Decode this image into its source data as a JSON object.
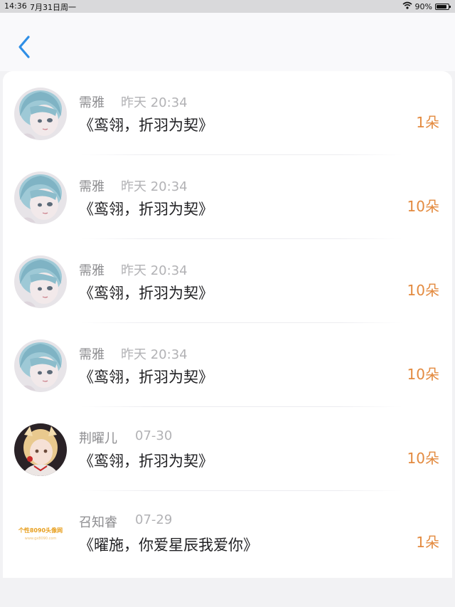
{
  "status_bar": {
    "time": "14:36",
    "date": "7月31日周一",
    "battery": "90%",
    "battery_level": 0.9
  },
  "nav": {
    "back_icon": "chevron-left-icon",
    "accent_color": "#2f8fe6"
  },
  "list": {
    "count_color": "#e38a3f",
    "items": [
      {
        "name": "需雅",
        "time": "昨天 20:34",
        "message": "《鸾翎，折羽为契》",
        "count": "1朵",
        "avatar": "anime-girl-blue-hair"
      },
      {
        "name": "需雅",
        "time": "昨天 20:34",
        "message": "《鸾翎，折羽为契》",
        "count": "10朵",
        "avatar": "anime-girl-blue-hair"
      },
      {
        "name": "需雅",
        "time": "昨天 20:34",
        "message": "《鸾翎，折羽为契》",
        "count": "10朵",
        "avatar": "anime-girl-blue-hair"
      },
      {
        "name": "需雅",
        "time": "昨天 20:34",
        "message": "《鸾翎，折羽为契》",
        "count": "10朵",
        "avatar": "anime-girl-blue-hair"
      },
      {
        "name": "荆曜儿",
        "time": "07-30",
        "message": "《鸾翎，折羽为契》",
        "count": "10朵",
        "avatar": "anime-girl-blonde"
      },
      {
        "name": "召知睿",
        "time": "07-29",
        "message": "《曜施，你爱星辰我爱你》",
        "count": "1朵",
        "avatar": "avatar-site-watermark",
        "avatar_text": "个性8090头像网",
        "avatar_subtext": "www.gx8090.com"
      }
    ]
  }
}
